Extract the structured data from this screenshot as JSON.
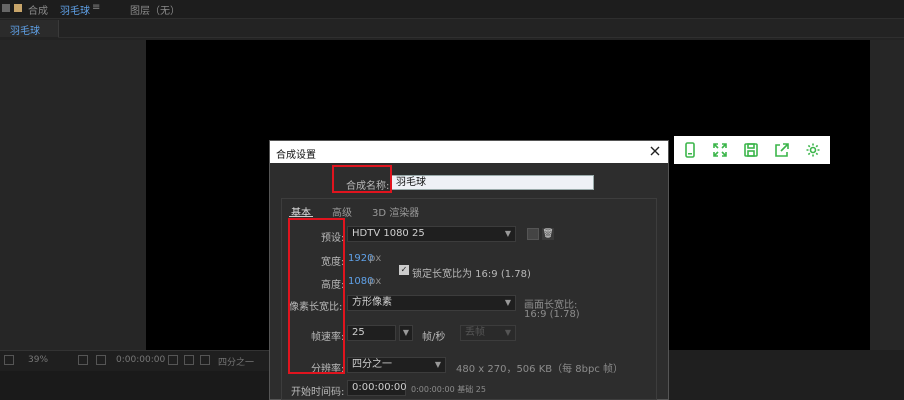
{
  "topbar": {
    "panel_label": "合成",
    "comp_name": "羽毛球",
    "menu_glyph": "≡",
    "layer_label": "图层（无）"
  },
  "comp_tab": {
    "label": "羽毛球"
  },
  "bottom_bar": {
    "zoom": "39%",
    "timecode": "0:00:00:00",
    "resolution": "四分之一"
  },
  "floating_toolbar": {
    "icons": [
      "phone-icon",
      "expand-icon",
      "save-icon",
      "share-icon",
      "settings-icon"
    ],
    "accent": "#3bb54a"
  },
  "dialog": {
    "title": "合成设置",
    "close_glyph": "✕",
    "name_label": "合成名称:",
    "name_value": "羽毛球",
    "tabs": [
      "基本",
      "高级",
      "3D 渲染器"
    ],
    "preset_label": "预设:",
    "preset_value": "HDTV 1080 25",
    "width_label": "宽度:",
    "width_value": "1920",
    "width_unit": "px",
    "height_label": "高度:",
    "height_value": "1080",
    "height_unit": "px",
    "lock_label": "锁定长宽比为 16:9 (1.78)",
    "lock_checked": true,
    "par_label": "像素长宽比:",
    "par_value": "方形像素",
    "frame_ar_label": "画面长宽比:",
    "frame_ar_value": "16:9 (1.78)",
    "fps_label": "帧速率:",
    "fps_value": "25",
    "fps_unit": "帧/秒",
    "fps_drop": "丢帧",
    "res_label": "分辨率:",
    "res_value": "四分之一",
    "res_info": "480 x 270，506 KB（每 8bpc 帧）",
    "start_label": "开始时间码:",
    "start_value": "0:00:00:00",
    "start_info": "0:00:00:00 基础 25"
  },
  "colors": {
    "highlight_red": "#e0141e",
    "link_blue": "#5fa1e8"
  }
}
